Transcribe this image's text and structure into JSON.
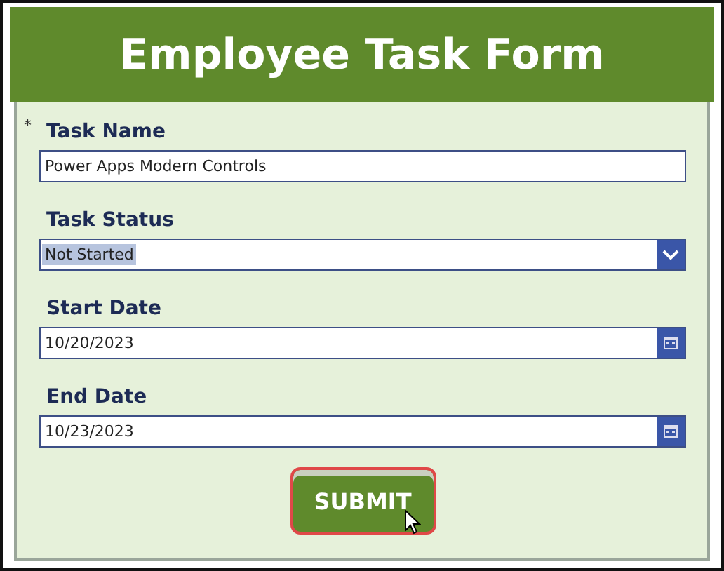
{
  "header": {
    "title": "Employee Task Form"
  },
  "fields": [
    {
      "kind": "text",
      "marker": "*",
      "label": "Task Name",
      "value": "Power Apps Modern Controls",
      "value_selected": false
    },
    {
      "kind": "dropdown",
      "label": "Task Status",
      "value": "Not Started",
      "value_selected": true
    },
    {
      "kind": "date",
      "label": "Start Date",
      "value": "10/20/2023",
      "value_selected": false
    },
    {
      "kind": "date",
      "label": "End Date",
      "value": "10/23/2023",
      "value_selected": false
    }
  ],
  "submit": {
    "label": "SUBMIT",
    "focused": true
  }
}
